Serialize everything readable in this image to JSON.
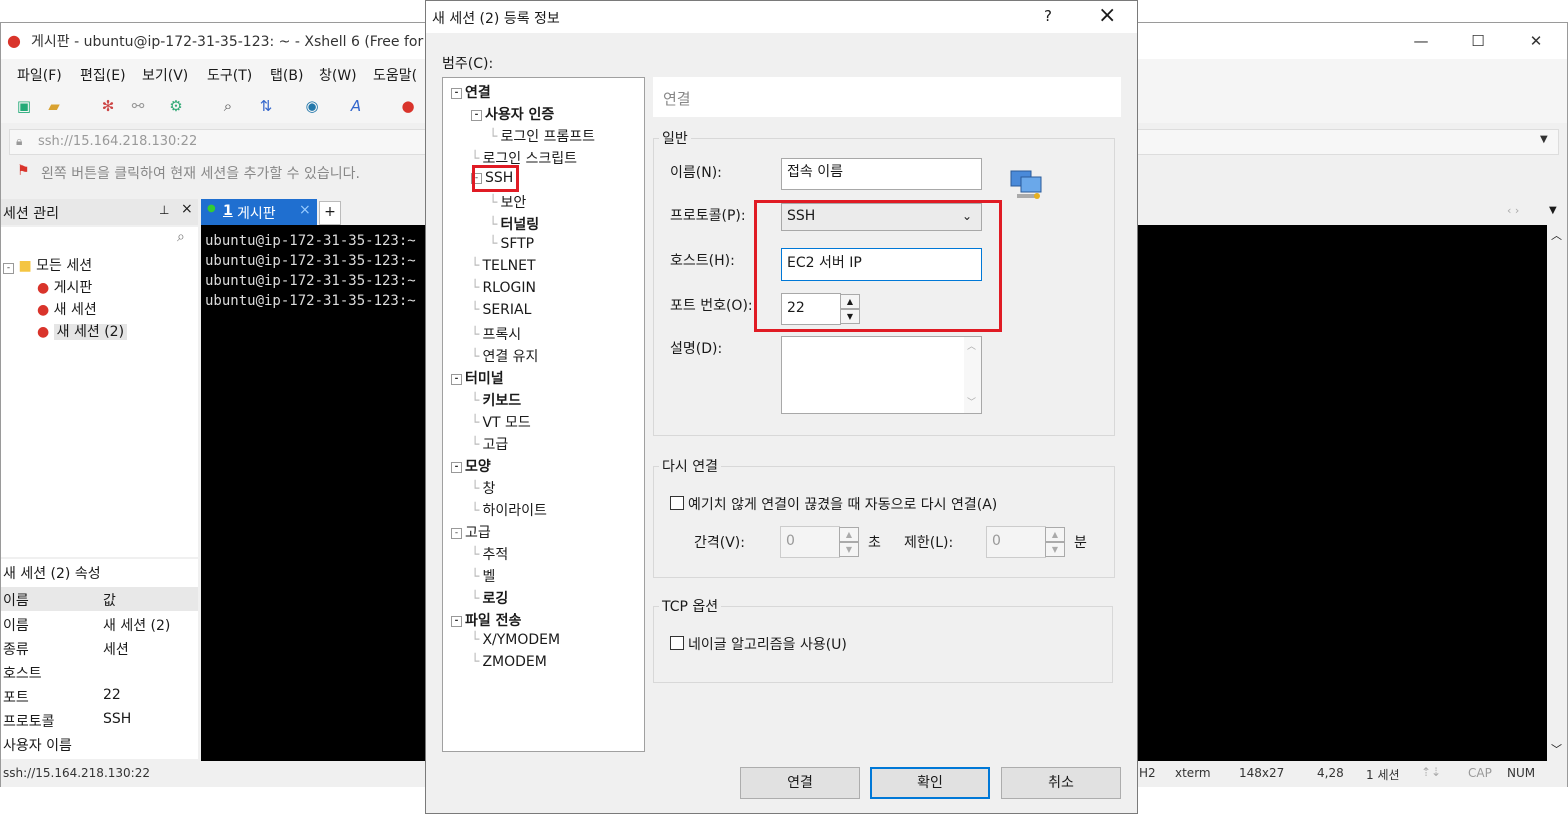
{
  "main_window": {
    "title": "게시판 - ubuntu@ip-172-31-35-123: ~ - Xshell 6 (Free for",
    "menu": [
      "파일(F)",
      "편집(E)",
      "보기(V)",
      "도구(T)",
      "탭(B)",
      "창(W)",
      "도움말("
    ],
    "address": "ssh://15.164.218.130:22",
    "hint": "왼쪽 버튼을 클릭하여 현재 세션을 추가할 수 있습니다."
  },
  "session_manager": {
    "title": "세션 관리",
    "pin": "ᵖ",
    "close": "×",
    "tree": [
      {
        "label": "모든 세션",
        "level": 0
      },
      {
        "label": "게시판",
        "level": 1
      },
      {
        "label": "새 세션",
        "level": 1
      },
      {
        "label": "새 세션 (2)",
        "level": 1
      }
    ],
    "props_title": "새 세션 (2) 속성",
    "props_header": [
      "이름",
      "값"
    ],
    "props": [
      {
        "name": "이름",
        "value": "새 세션 (2)"
      },
      {
        "name": "종류",
        "value": "세션"
      },
      {
        "name": "호스트",
        "value": ""
      },
      {
        "name": "포트",
        "value": "22"
      },
      {
        "name": "프로토콜",
        "value": "SSH"
      },
      {
        "name": "사용자 이름",
        "value": ""
      }
    ]
  },
  "terminal": {
    "tab_num": "1",
    "tab_label": "게시판",
    "lines": [
      "ubuntu@ip-172-31-35-123:~",
      "ubuntu@ip-172-31-35-123:~",
      "ubuntu@ip-172-31-35-123:~",
      "ubuntu@ip-172-31-35-123:~"
    ]
  },
  "status_bar": {
    "left": "ssh://15.164.218.130:22",
    "items": [
      "H2",
      "xterm",
      "148x27",
      "4,28",
      "1 세션",
      "CAP",
      "NUM"
    ]
  },
  "dialog": {
    "title": "새 세션 (2) 등록 정보",
    "help": "?",
    "close": "×",
    "category_label": "범주(C):",
    "tree": [
      {
        "label": "연결",
        "level": 0,
        "bold": true,
        "exp": "-"
      },
      {
        "label": "사용자 인증",
        "level": 1,
        "bold": true,
        "exp": "-"
      },
      {
        "label": "로그인 프롬프트",
        "level": 2,
        "bold": false
      },
      {
        "label": "로그인 스크립트",
        "level": 1,
        "bold": false
      },
      {
        "label": "SSH",
        "level": 1,
        "bold": false,
        "exp": "-"
      },
      {
        "label": "보안",
        "level": 2,
        "bold": false
      },
      {
        "label": "터널링",
        "level": 2,
        "bold": true
      },
      {
        "label": "SFTP",
        "level": 2,
        "bold": false
      },
      {
        "label": "TELNET",
        "level": 1,
        "bold": false
      },
      {
        "label": "RLOGIN",
        "level": 1,
        "bold": false
      },
      {
        "label": "SERIAL",
        "level": 1,
        "bold": false
      },
      {
        "label": "프록시",
        "level": 1,
        "bold": false
      },
      {
        "label": "연결 유지",
        "level": 1,
        "bold": false
      },
      {
        "label": "터미널",
        "level": 0,
        "bold": true,
        "exp": "-"
      },
      {
        "label": "키보드",
        "level": 1,
        "bold": true
      },
      {
        "label": "VT 모드",
        "level": 1,
        "bold": false
      },
      {
        "label": "고급",
        "level": 1,
        "bold": false
      },
      {
        "label": "모양",
        "level": 0,
        "bold": true,
        "exp": "-"
      },
      {
        "label": "창",
        "level": 1,
        "bold": false
      },
      {
        "label": "하이라이트",
        "level": 1,
        "bold": false
      },
      {
        "label": "고급",
        "level": 0,
        "bold": false,
        "exp": "-"
      },
      {
        "label": "추적",
        "level": 1,
        "bold": false
      },
      {
        "label": "벨",
        "level": 1,
        "bold": false
      },
      {
        "label": "로깅",
        "level": 1,
        "bold": true
      },
      {
        "label": "파일 전송",
        "level": 0,
        "bold": true,
        "exp": "-"
      },
      {
        "label": "X/YMODEM",
        "level": 1,
        "bold": false
      },
      {
        "label": "ZMODEM",
        "level": 1,
        "bold": false
      }
    ],
    "section": "연결",
    "general": {
      "title": "일반",
      "name_label": "이름(N):",
      "name_value": "접속 이름",
      "protocol_label": "프로토콜(P):",
      "protocol_value": "SSH",
      "host_label": "호스트(H):",
      "host_value": "EC2 서버 IP",
      "port_label": "포트 번호(O):",
      "port_value": "22",
      "desc_label": "설명(D):"
    },
    "reconnect": {
      "title": "다시 연결",
      "checkbox_label": "예기치 않게 연결이 끊겼을 때 자동으로 다시 연결(A)",
      "interval_label": "간격(V):",
      "interval_value": "0",
      "interval_unit": "초",
      "limit_label": "제한(L):",
      "limit_value": "0",
      "limit_unit": "분"
    },
    "tcp": {
      "title": "TCP 옵션",
      "checkbox_label": "네이글 알고리즘을 사용(U)"
    },
    "buttons": {
      "connect": "연결",
      "ok": "확인",
      "cancel": "취소"
    }
  },
  "colors": {
    "highlight": "#e01b24",
    "accent": "#0078d7"
  }
}
